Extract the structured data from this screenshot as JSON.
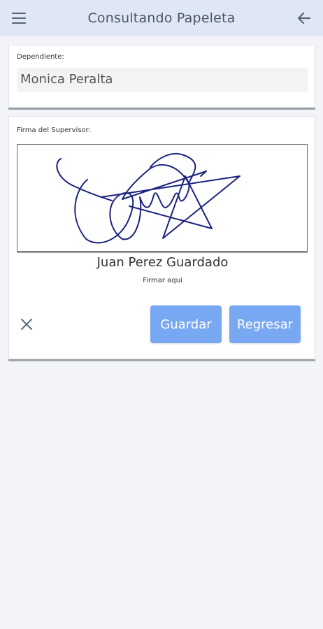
{
  "header": {
    "title": "Consultando Papeleta",
    "menu_icon": "hamburger-menu-icon",
    "back_icon": "arrow-left-icon"
  },
  "employee": {
    "label": "Dependiente:",
    "value": "Monica Peralta"
  },
  "signature": {
    "label": "Firma del Supervisor:",
    "signer_name": "Juan Perez Guardado",
    "instruction": "Firmar aqui",
    "stroke_color": "#1a237e"
  },
  "actions": {
    "clear_icon": "close-icon",
    "save_label": "Guardar",
    "back_label": "Regresar"
  },
  "colors": {
    "appbar": "#dfe7f6",
    "button": "#79a8f2",
    "background": "#f3f4f7"
  }
}
